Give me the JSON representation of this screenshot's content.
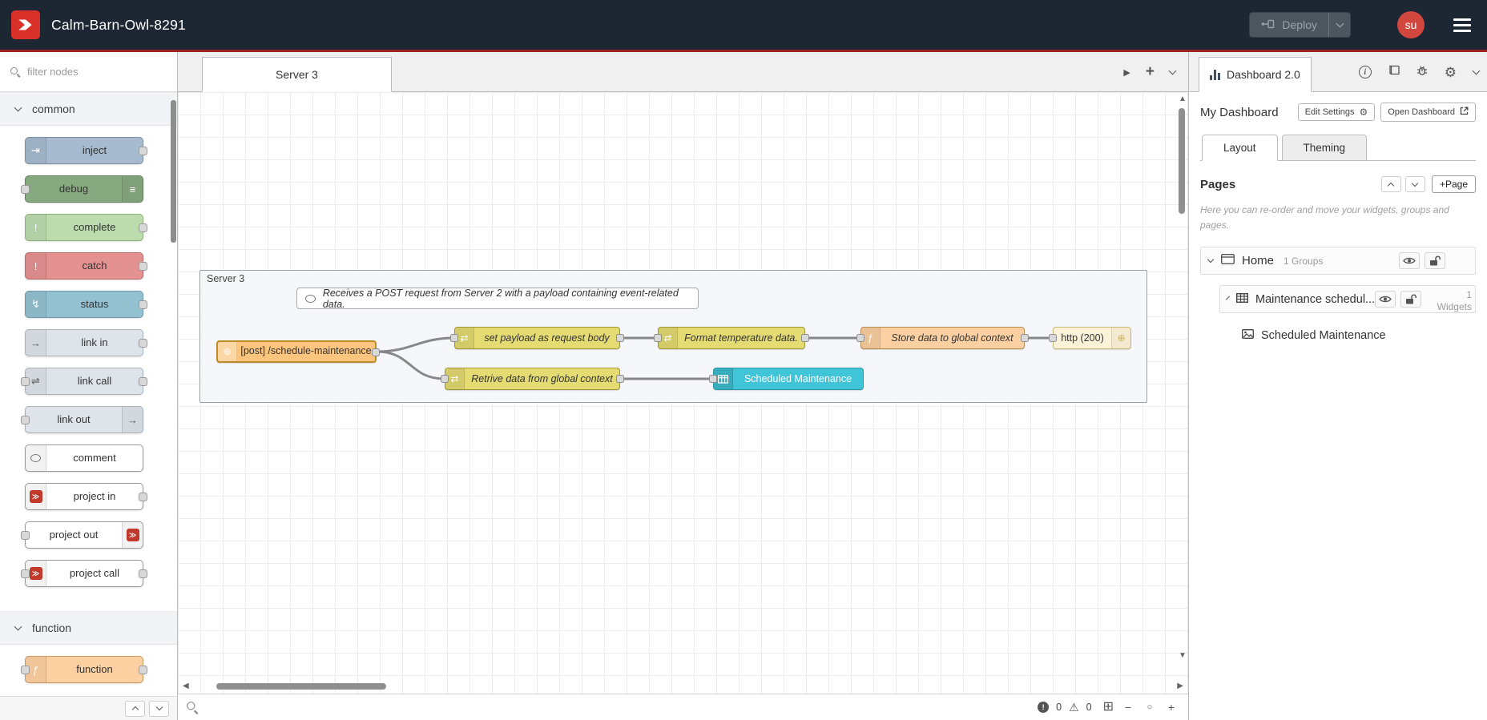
{
  "colors": {
    "header_bg": "#1c2733",
    "header_underline": "#9b2420",
    "brand_red": "#d9312a",
    "node_inject": "#a6bbcf",
    "node_debug": "#87a980",
    "node_complete": "#bcdcae",
    "node_catch": "#e49191",
    "node_status": "#94c1d0",
    "node_link": "#dee4ea",
    "node_function": "#fdd0a2",
    "node_change": "#e4db72",
    "node_http_in": "#fcc57e",
    "node_http_response": "#fdf3d8",
    "node_table_widget": "#3fc4d8"
  },
  "header": {
    "title": "Calm-Barn-Owl-8291",
    "deploy_label": "Deploy",
    "avatar_initials": "su"
  },
  "palette": {
    "filter_placeholder": "filter nodes",
    "category_common": "common",
    "category_function": "function",
    "common_nodes": [
      {
        "label": "inject"
      },
      {
        "label": "debug"
      },
      {
        "label": "complete"
      },
      {
        "label": "catch"
      },
      {
        "label": "status"
      },
      {
        "label": "link in"
      },
      {
        "label": "link call"
      },
      {
        "label": "link out"
      },
      {
        "label": "comment"
      },
      {
        "label": "project in"
      },
      {
        "label": "project out"
      },
      {
        "label": "project call"
      }
    ],
    "function_nodes": [
      {
        "label": "function"
      }
    ]
  },
  "workspace": {
    "tab_label": "Server 3",
    "group_label": "Server 3",
    "comment_text": "Receives a POST request from Server 2 with a payload containing event-related data.",
    "nodes": {
      "http_in": "[post] /schedule-maintenance",
      "set_payload": "set payload as request body",
      "format_temperature": "Format temperature data.",
      "store_global": "Store data to global context",
      "http_response": "http (200)",
      "retrieve_global": "Retrive data from global context",
      "table_widget": "Scheduled Maintenance"
    },
    "status": {
      "errors": "0",
      "warnings": "0"
    }
  },
  "sidebar": {
    "active_tab": "Dashboard 2.0",
    "dashboard_name": "My Dashboard",
    "edit_settings_label": "Edit Settings",
    "open_dashboard_label": "Open Dashboard",
    "tabs": {
      "layout": "Layout",
      "theming": "Theming"
    },
    "pages_title": "Pages",
    "add_page_label": "+Page",
    "help_text": "Here you can re-order and move your widgets, groups and pages.",
    "tree": {
      "page_label": "Home",
      "page_meta": "1 Groups",
      "group_label": "Maintenance schedul...",
      "group_meta": "1 Widgets",
      "widget_label": "Scheduled Maintenance"
    }
  }
}
